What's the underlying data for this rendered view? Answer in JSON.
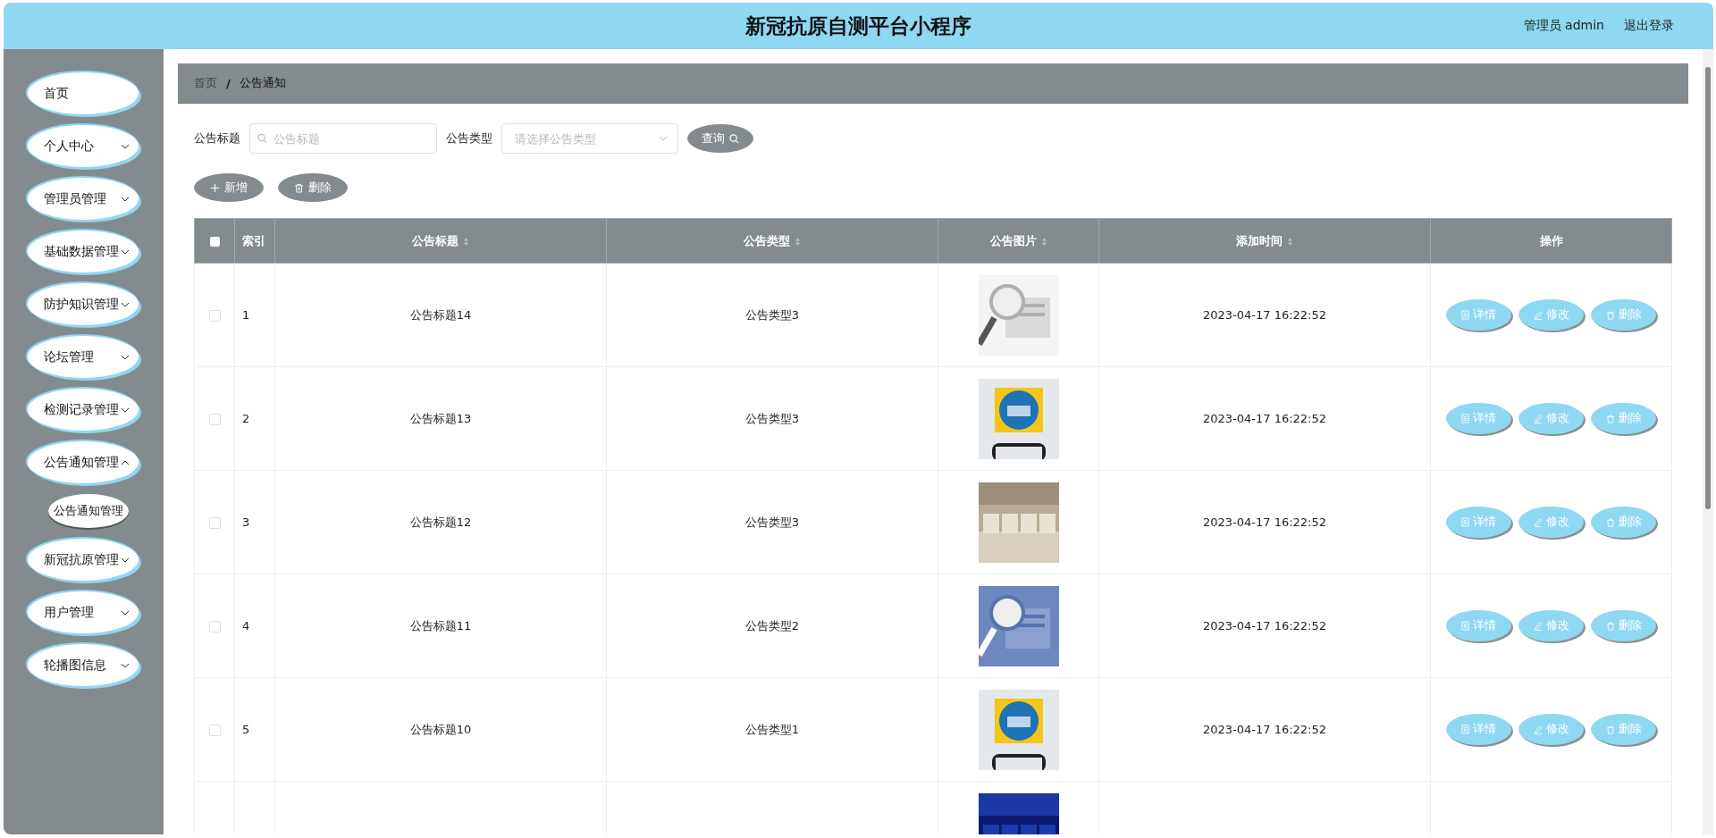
{
  "header": {
    "title": "新冠抗原自测平台小程序",
    "user": "管理员 admin",
    "logout": "退出登录"
  },
  "sidebar": {
    "items": [
      {
        "label": "首页",
        "expandable": false
      },
      {
        "label": "个人中心",
        "expandable": true,
        "expanded": false
      },
      {
        "label": "管理员管理",
        "expandable": true,
        "expanded": false
      },
      {
        "label": "基础数据管理",
        "expandable": true,
        "expanded": false
      },
      {
        "label": "防护知识管理",
        "expandable": true,
        "expanded": false
      },
      {
        "label": "论坛管理",
        "expandable": true,
        "expanded": false
      },
      {
        "label": "检测记录管理",
        "expandable": true,
        "expanded": false
      },
      {
        "label": "公告通知管理",
        "expandable": true,
        "expanded": true,
        "children": [
          {
            "label": "公告通知管理"
          }
        ]
      },
      {
        "label": "新冠抗原管理",
        "expandable": true,
        "expanded": false
      },
      {
        "label": "用户管理",
        "expandable": true,
        "expanded": false
      },
      {
        "label": "轮播图信息",
        "expandable": true,
        "expanded": false
      }
    ]
  },
  "breadcrumb": {
    "items": [
      "首页",
      "公告通知"
    ],
    "separator": "/"
  },
  "filters": [
    {
      "label": "公告标题",
      "kind": "input",
      "placeholder": "公告标题"
    },
    {
      "label": "公告类型",
      "kind": "select",
      "placeholder": "请选择公告类型"
    }
  ],
  "search_button": "查询",
  "actions": [
    {
      "label": "新增",
      "kind": "add"
    },
    {
      "label": "删除",
      "kind": "delete"
    }
  ],
  "table": {
    "select_all_checked": false,
    "columns": [
      {
        "label": "索引",
        "sortable": false
      },
      {
        "label": "公告标题",
        "sortable": true
      },
      {
        "label": "公告类型",
        "sortable": true
      },
      {
        "label": "公告图片",
        "sortable": true
      },
      {
        "label": "添加时间",
        "sortable": true
      },
      {
        "label": "操作",
        "sortable": false
      }
    ],
    "rows": [
      {
        "selected": false,
        "index": "1",
        "title": "公告标题14",
        "type": "公告类型3",
        "image": {
          "kind": "picture"
        },
        "time": "2023-04-17 16:22:52",
        "buttons": [
          {
            "label": "详情",
            "kind": "detail"
          },
          {
            "label": "修改",
            "kind": "edit"
          },
          {
            "label": "删除",
            "kind": "delete"
          }
        ]
      },
      {
        "selected": false,
        "index": "2",
        "title": "公告标题13",
        "type": "公告类型3",
        "image": {
          "kind": "picture"
        },
        "time": "2023-04-17 16:22:52",
        "buttons": [
          {
            "label": "详情",
            "kind": "detail"
          },
          {
            "label": "修改",
            "kind": "edit"
          },
          {
            "label": "删除",
            "kind": "delete"
          }
        ]
      },
      {
        "selected": false,
        "index": "3",
        "title": "公告标题12",
        "type": "公告类型3",
        "image": {
          "kind": "picture"
        },
        "time": "2023-04-17 16:22:52",
        "buttons": [
          {
            "label": "详情",
            "kind": "detail"
          },
          {
            "label": "修改",
            "kind": "edit"
          },
          {
            "label": "删除",
            "kind": "delete"
          }
        ]
      },
      {
        "selected": false,
        "index": "4",
        "title": "公告标题11",
        "type": "公告类型2",
        "image": {
          "kind": "picture"
        },
        "time": "2023-04-17 16:22:52",
        "buttons": [
          {
            "label": "详情",
            "kind": "detail"
          },
          {
            "label": "修改",
            "kind": "edit"
          },
          {
            "label": "删除",
            "kind": "delete"
          }
        ]
      },
      {
        "selected": false,
        "index": "5",
        "title": "公告标题10",
        "type": "公告类型1",
        "image": {
          "kind": "picture"
        },
        "time": "2023-04-17 16:22:52",
        "buttons": [
          {
            "label": "详情",
            "kind": "detail"
          },
          {
            "label": "修改",
            "kind": "edit"
          },
          {
            "label": "删除",
            "kind": "delete"
          }
        ]
      },
      {
        "image": {
          "kind": "picture"
        }
      }
    ]
  }
}
